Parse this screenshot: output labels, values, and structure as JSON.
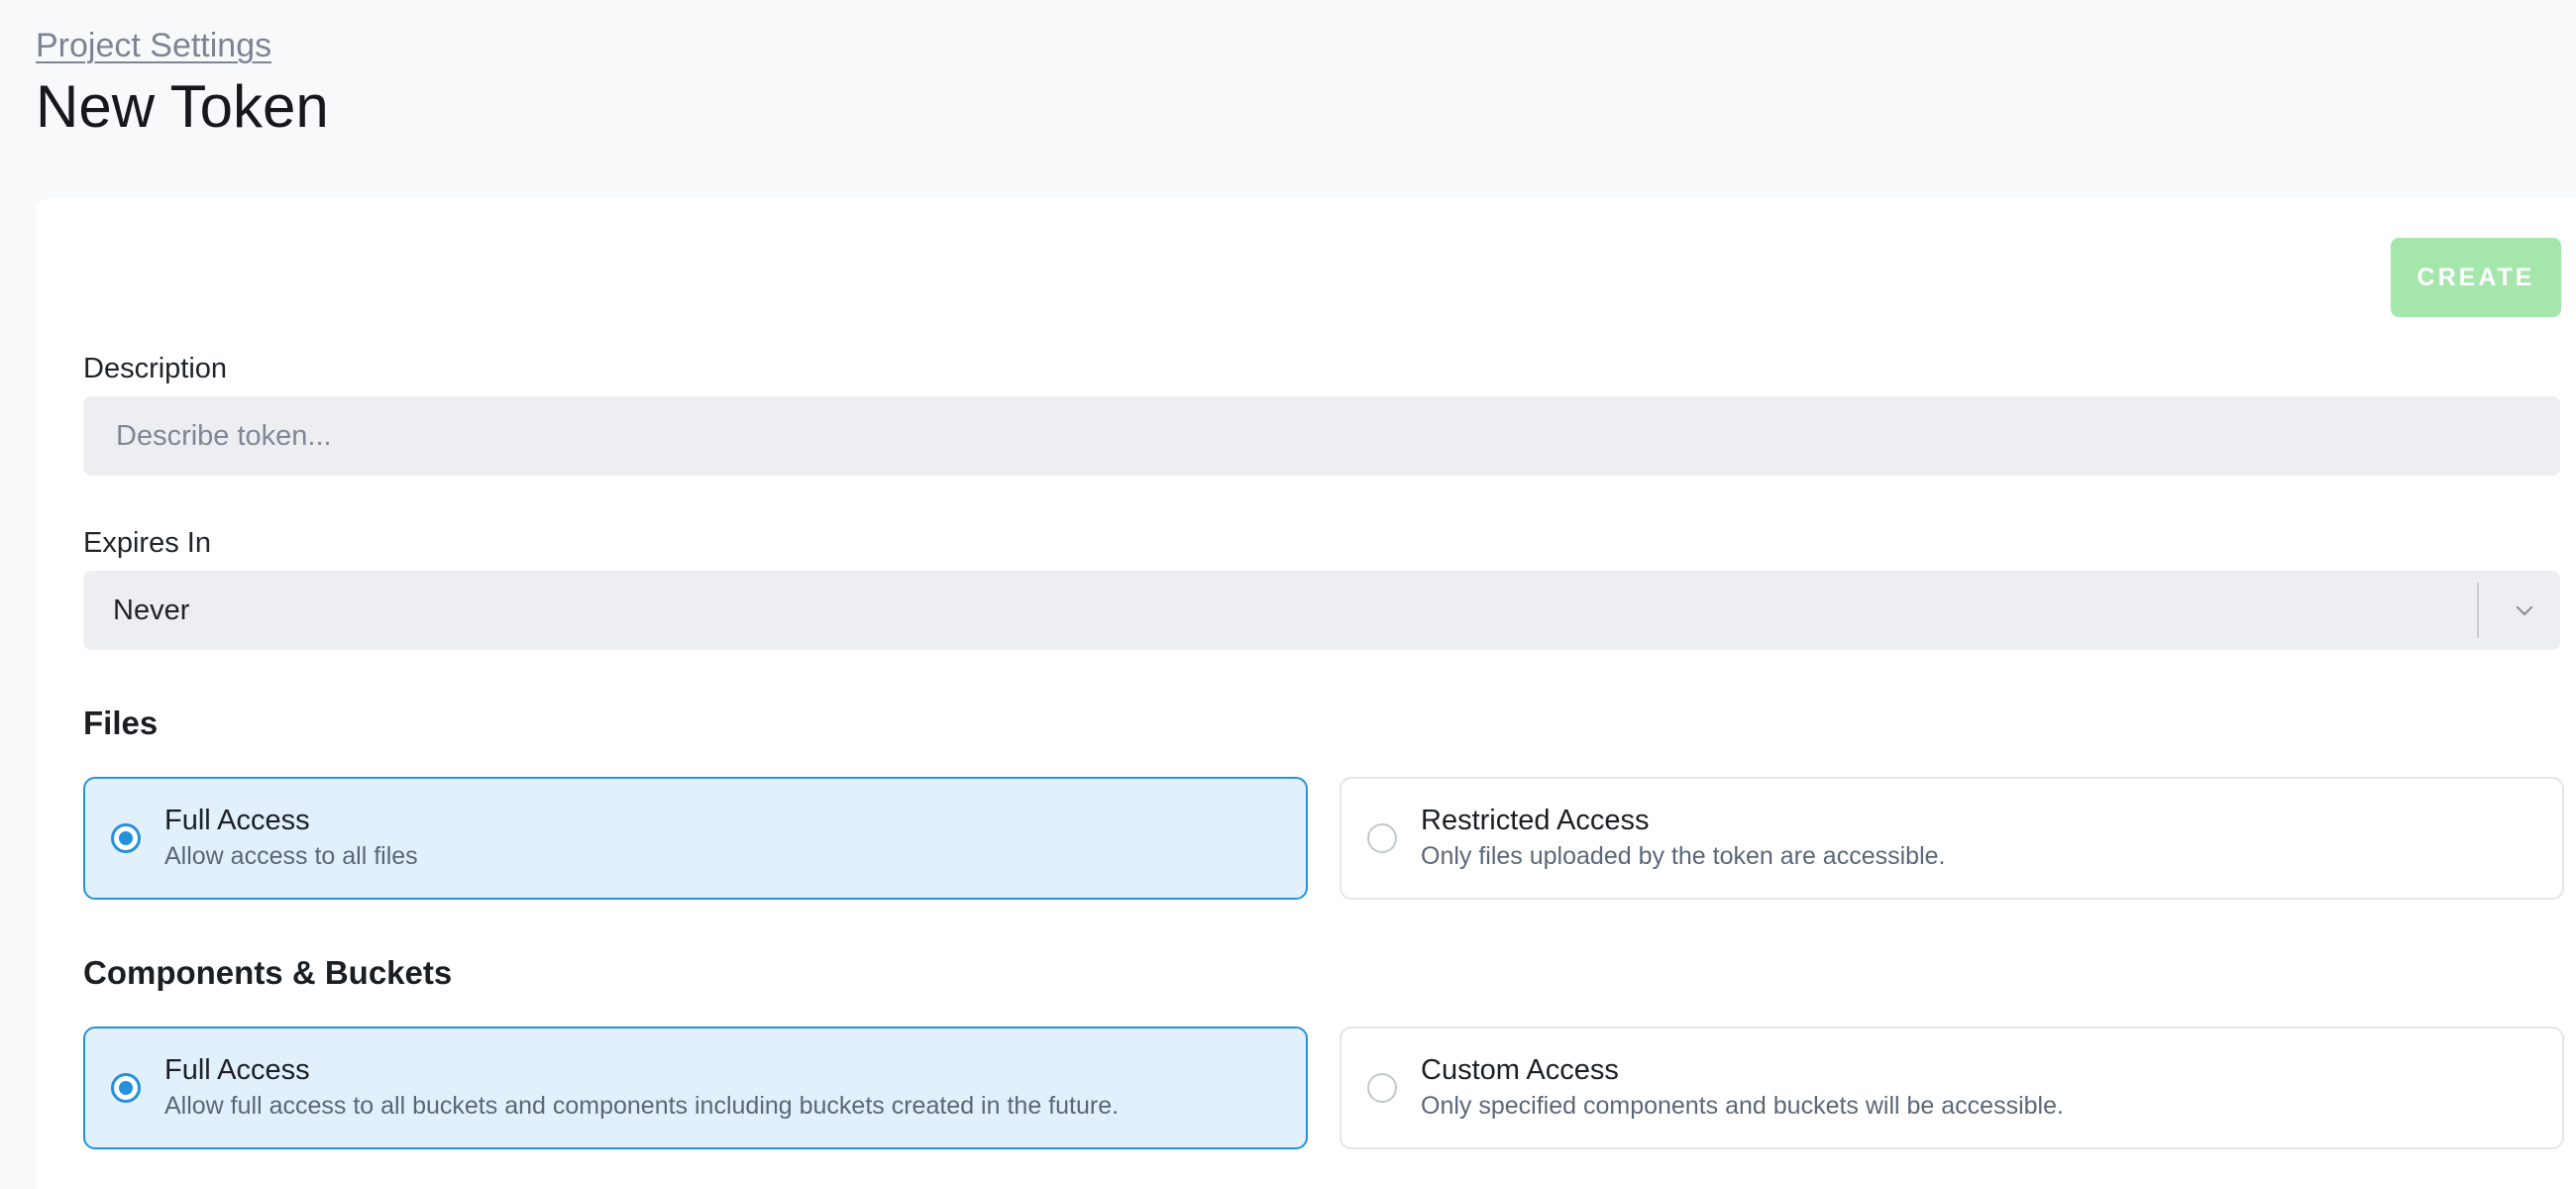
{
  "breadcrumb": {
    "label": "Project Settings"
  },
  "page": {
    "title": "New Token"
  },
  "actions": {
    "create_label": "CREATE"
  },
  "description": {
    "label": "Description",
    "value": "",
    "placeholder": "Describe token..."
  },
  "expires": {
    "label": "Expires In",
    "value": "Never"
  },
  "files": {
    "title": "Files",
    "options": [
      {
        "title": "Full Access",
        "description": "Allow access to all files",
        "selected": true
      },
      {
        "title": "Restricted Access",
        "description": "Only files uploaded by the token are accessible.",
        "selected": false
      }
    ]
  },
  "components": {
    "title": "Components & Buckets",
    "options": [
      {
        "title": "Full Access",
        "description": "Allow full access to all buckets and components including buckets created in the future.",
        "selected": true
      },
      {
        "title": "Custom Access",
        "description": "Only specified components and buckets will be accessible.",
        "selected": false
      }
    ]
  },
  "colors": {
    "accent": "#2591dc",
    "selected_background": "#e1f0fb",
    "create_button": "#a5e6ad"
  }
}
